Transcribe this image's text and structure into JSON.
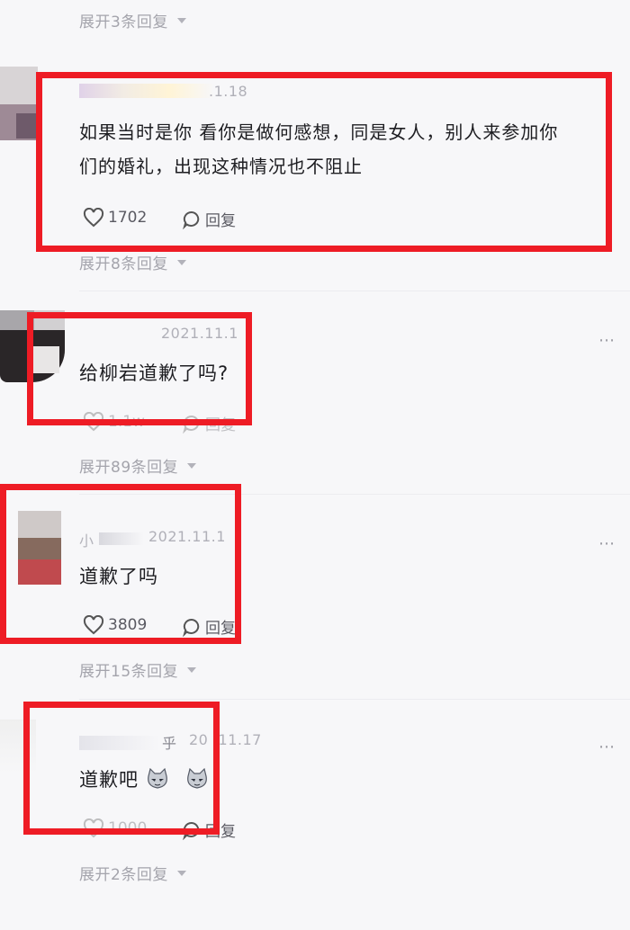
{
  "comments": [
    {
      "expand_prev": "展开3条回复",
      "time": ".1.18",
      "text_line1": "如果当时是你 看你是做何感想，同是女人，别人来参加你",
      "text_line2": "们的婚礼，出现这种情况也不阻止",
      "likes": "1702",
      "reply_label": "回复",
      "expand": "展开8条回复"
    },
    {
      "time": "2021.11.1",
      "text": "给柳岩道歉了吗?",
      "likes": "1.1w",
      "reply_label": "回复",
      "expand": "展开89条回复"
    },
    {
      "nick": "小",
      "time": "2021.11.1",
      "text": "道歉了吗",
      "likes": "3809",
      "reply_label": "回复",
      "expand": "展开15条回复"
    },
    {
      "nick_tail": "乎",
      "time": "20 .11.17",
      "text": "道歉吧",
      "likes": "1000",
      "reply_label": "回复",
      "expand": "展开2条回复"
    }
  ],
  "more_icon": "⋯",
  "colors": {
    "highlight": "#ee1c25"
  }
}
